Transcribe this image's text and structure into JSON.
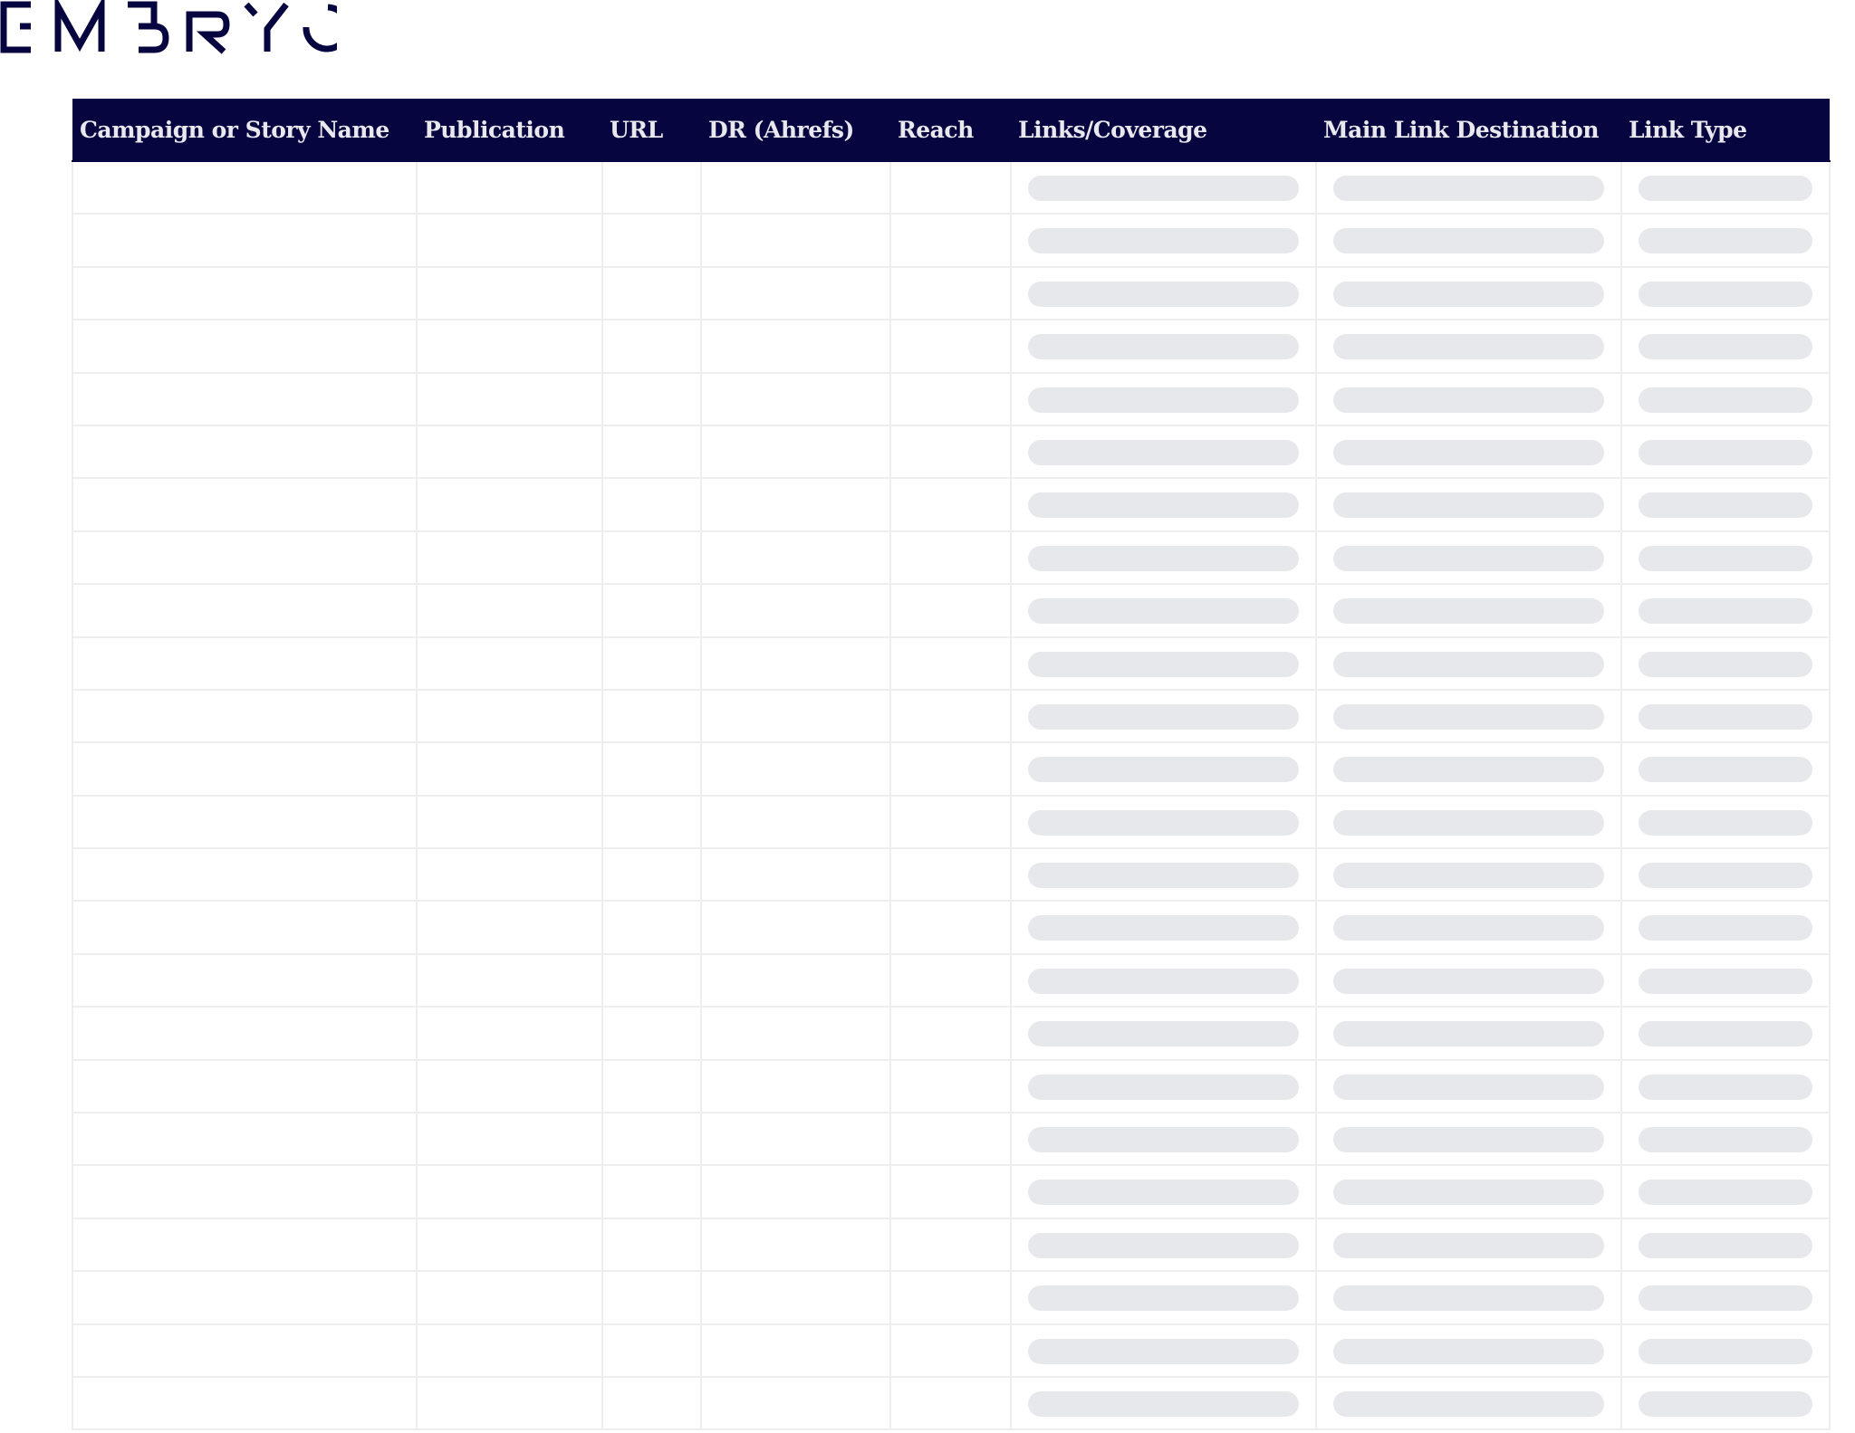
{
  "brand": {
    "logo_text": "EMBRYO",
    "logo_color": "#070540"
  },
  "table": {
    "header_bg": "#070540",
    "columns": [
      {
        "label": "Campaign or Story Name"
      },
      {
        "label": "Publication"
      },
      {
        "label": "URL"
      },
      {
        "label": "DR (Ahrefs)"
      },
      {
        "label": "Reach"
      },
      {
        "label": "Links/Coverage"
      },
      {
        "label": "Main Link Destination"
      },
      {
        "label": "Link Type"
      }
    ],
    "row_count": 24,
    "placeholder_columns": [
      "Links/Coverage",
      "Main Link Destination",
      "Link Type"
    ],
    "placeholder_color": "#e7e8ec"
  }
}
